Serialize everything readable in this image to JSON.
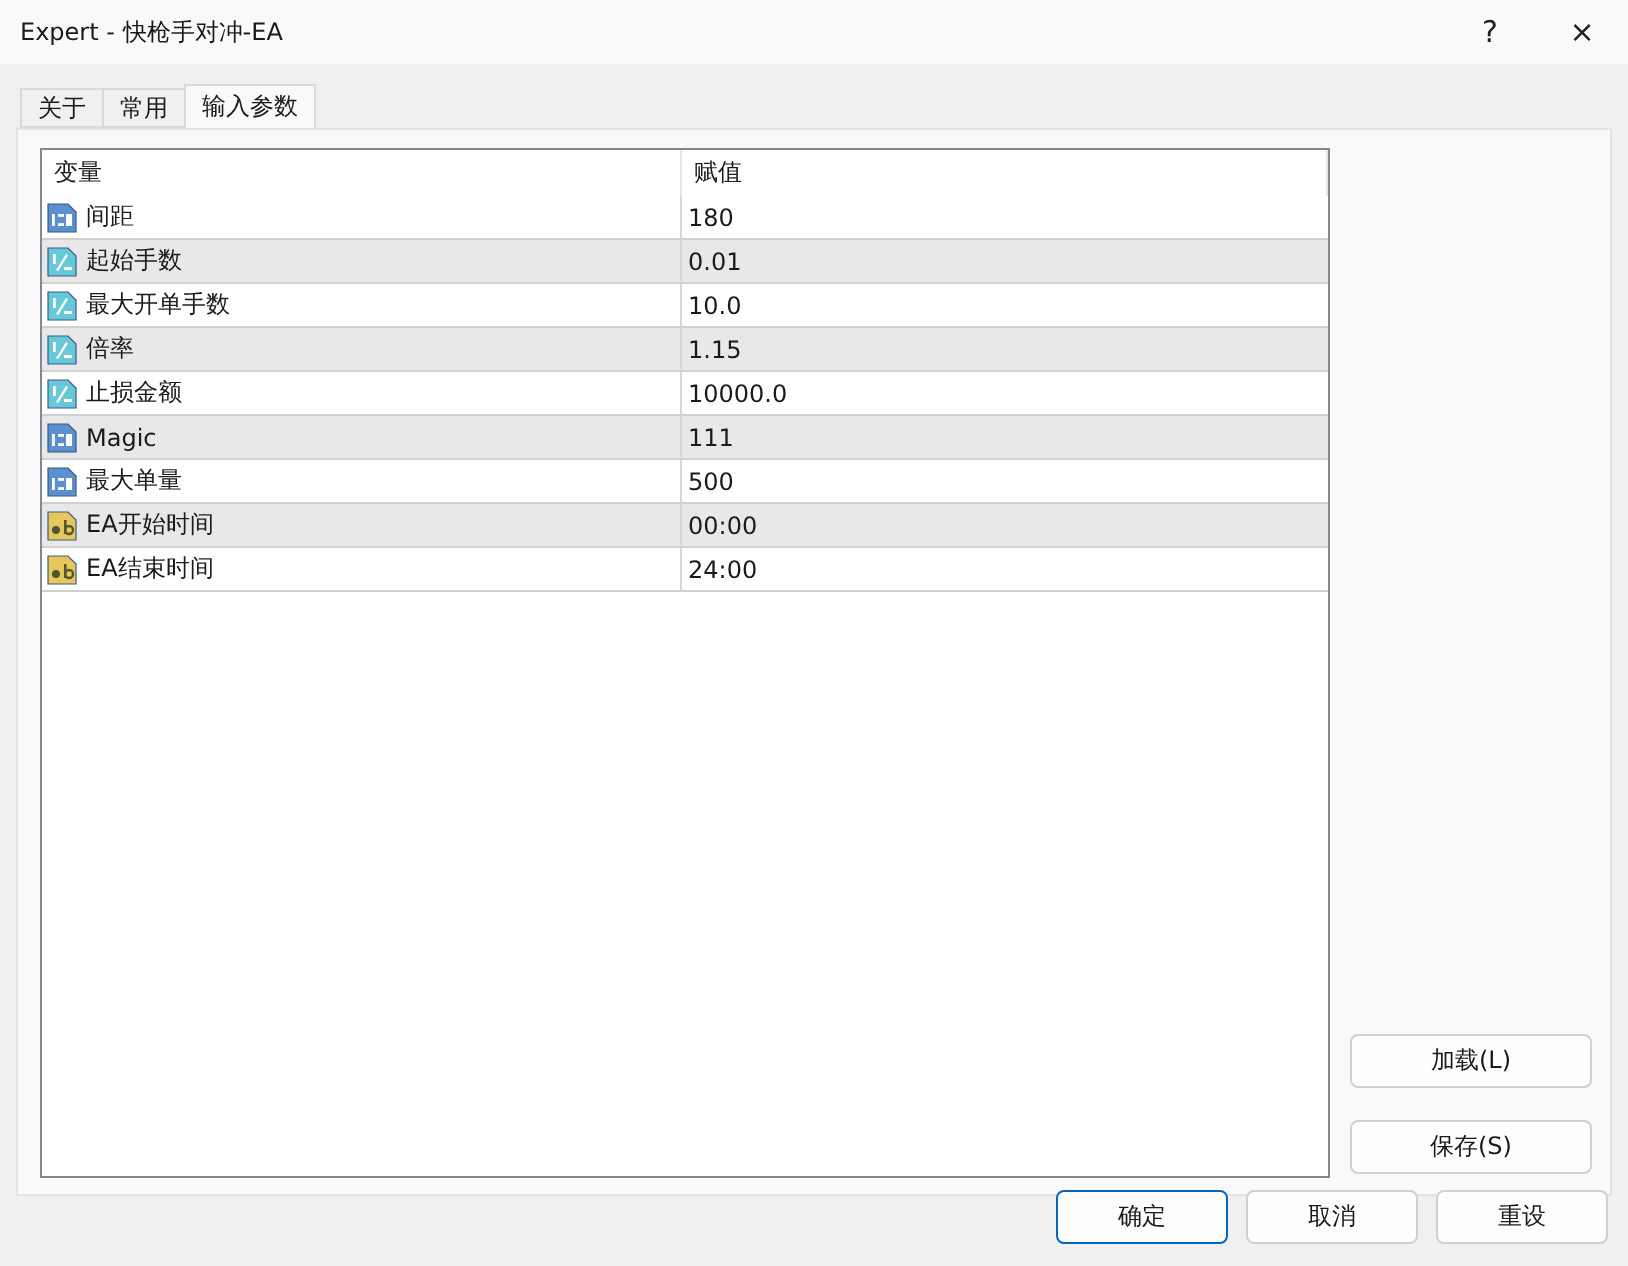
{
  "window": {
    "title": "Expert - 快枪手对冲-EA",
    "help": "?",
    "close": "×"
  },
  "tabs": [
    {
      "label": "关于",
      "selected": false
    },
    {
      "label": "常用",
      "selected": false
    },
    {
      "label": "输入参数",
      "selected": true
    }
  ],
  "table": {
    "columns": [
      "变量",
      "赋值"
    ],
    "rows": [
      {
        "kind": "int",
        "name": "间距",
        "value": "180"
      },
      {
        "kind": "double",
        "name": "起始手数",
        "value": "0.01"
      },
      {
        "kind": "double",
        "name": "最大开单手数",
        "value": "10.0"
      },
      {
        "kind": "double",
        "name": "倍率",
        "value": "1.15"
      },
      {
        "kind": "double",
        "name": "止损金额",
        "value": "10000.0"
      },
      {
        "kind": "int",
        "name": "Magic",
        "value": "111"
      },
      {
        "kind": "int",
        "name": "最大单量",
        "value": "500"
      },
      {
        "kind": "string",
        "name": "EA开始时间",
        "value": "00:00"
      },
      {
        "kind": "string",
        "name": "EA结束时间",
        "value": "24:00"
      }
    ]
  },
  "side_buttons": [
    "加载(L)",
    "保存(S)"
  ],
  "footer_buttons": [
    {
      "label": "确定",
      "default": true
    },
    {
      "label": "取消",
      "default": false
    },
    {
      "label": "重设",
      "default": false
    }
  ]
}
